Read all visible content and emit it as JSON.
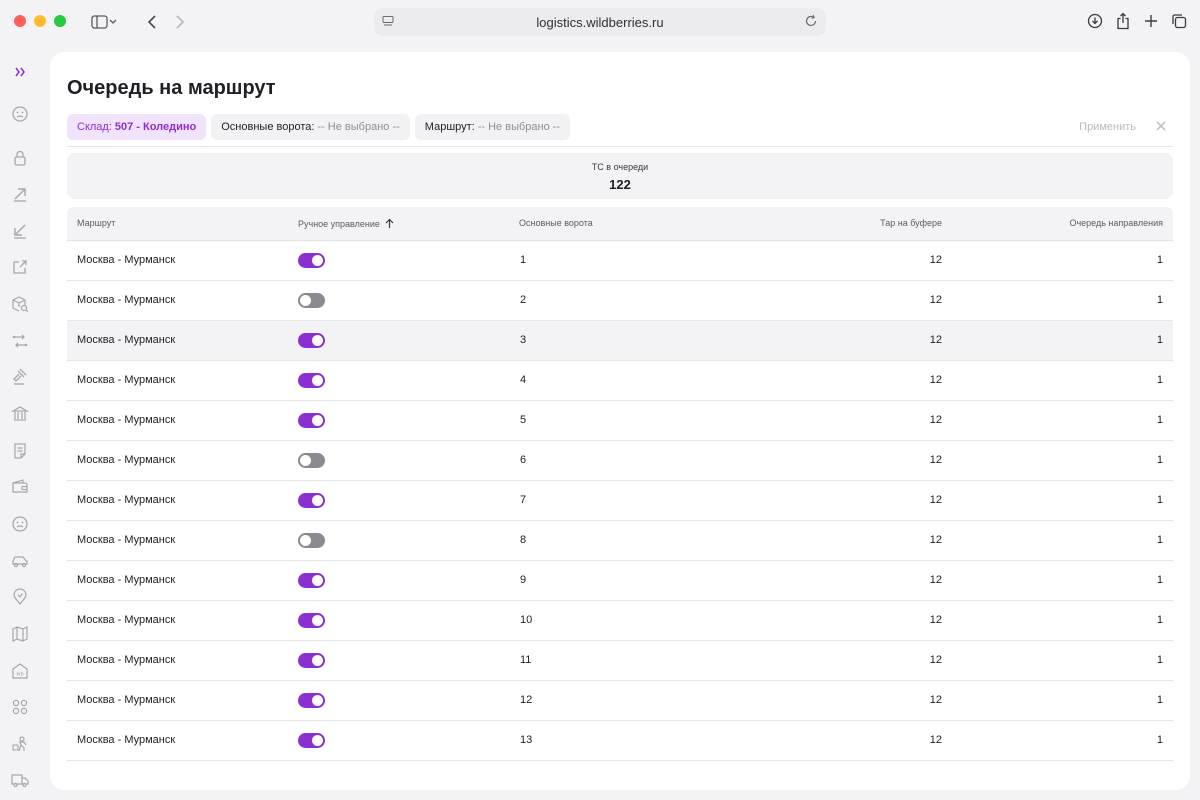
{
  "browser": {
    "url": "logistics.wildberries.ru"
  },
  "page": {
    "title": "Очередь на маршрут"
  },
  "filters": {
    "warehouse": {
      "label": "Склад:",
      "value": "507 - Коледино"
    },
    "gate": {
      "label": "Основные ворота:",
      "value": "-- Не выбрано --"
    },
    "route": {
      "label": "Маршрут:",
      "value": "-- Не выбрано --"
    },
    "apply_label": "Применить"
  },
  "stat": {
    "label": "ТС в очереди",
    "value": "122"
  },
  "table": {
    "columns": {
      "route": "Маршрут",
      "manual": "Ручное управление",
      "gate": "Основные ворота",
      "tare": "Тар на буфере",
      "queue": "Очередь направления"
    },
    "rows": [
      {
        "route": "Москва - Мурманск",
        "manual": true,
        "gate": "1",
        "tare": "12",
        "queue": "1"
      },
      {
        "route": "Москва - Мурманск",
        "manual": false,
        "gate": "2",
        "tare": "12",
        "queue": "1"
      },
      {
        "route": "Москва - Мурманск",
        "manual": true,
        "gate": "3",
        "tare": "12",
        "queue": "1"
      },
      {
        "route": "Москва - Мурманск",
        "manual": true,
        "gate": "4",
        "tare": "12",
        "queue": "1"
      },
      {
        "route": "Москва - Мурманск",
        "manual": true,
        "gate": "5",
        "tare": "12",
        "queue": "1"
      },
      {
        "route": "Москва - Мурманск",
        "manual": false,
        "gate": "6",
        "tare": "12",
        "queue": "1"
      },
      {
        "route": "Москва - Мурманск",
        "manual": true,
        "gate": "7",
        "tare": "12",
        "queue": "1"
      },
      {
        "route": "Москва - Мурманск",
        "manual": false,
        "gate": "8",
        "tare": "12",
        "queue": "1"
      },
      {
        "route": "Москва - Мурманск",
        "manual": true,
        "gate": "9",
        "tare": "12",
        "queue": "1"
      },
      {
        "route": "Москва - Мурманск",
        "manual": true,
        "gate": "10",
        "tare": "12",
        "queue": "1"
      },
      {
        "route": "Москва - Мурманск",
        "manual": true,
        "gate": "11",
        "tare": "12",
        "queue": "1"
      },
      {
        "route": "Москва - Мурманск",
        "manual": true,
        "gate": "12",
        "tare": "12",
        "queue": "1"
      },
      {
        "route": "Москва - Мурманск",
        "manual": true,
        "gate": "13",
        "tare": "12",
        "queue": "1"
      }
    ]
  },
  "colors": {
    "accent": "#8b2fd1",
    "toggle_off": "#8a8a92"
  },
  "sidebar": {
    "icons": [
      "expand-icon",
      "face-icon",
      "lock-icon",
      "arrow-up-right-icon",
      "arrow-down-left-icon",
      "external-link-icon",
      "box-search-icon",
      "transfer-icon",
      "gavel-icon",
      "bank-icon",
      "document-icon",
      "wallet-icon",
      "face-icon",
      "car-icon",
      "location-icon",
      "map-icon",
      "warehouse-icon",
      "grid-icon",
      "worker-icon",
      "truck-icon"
    ]
  }
}
